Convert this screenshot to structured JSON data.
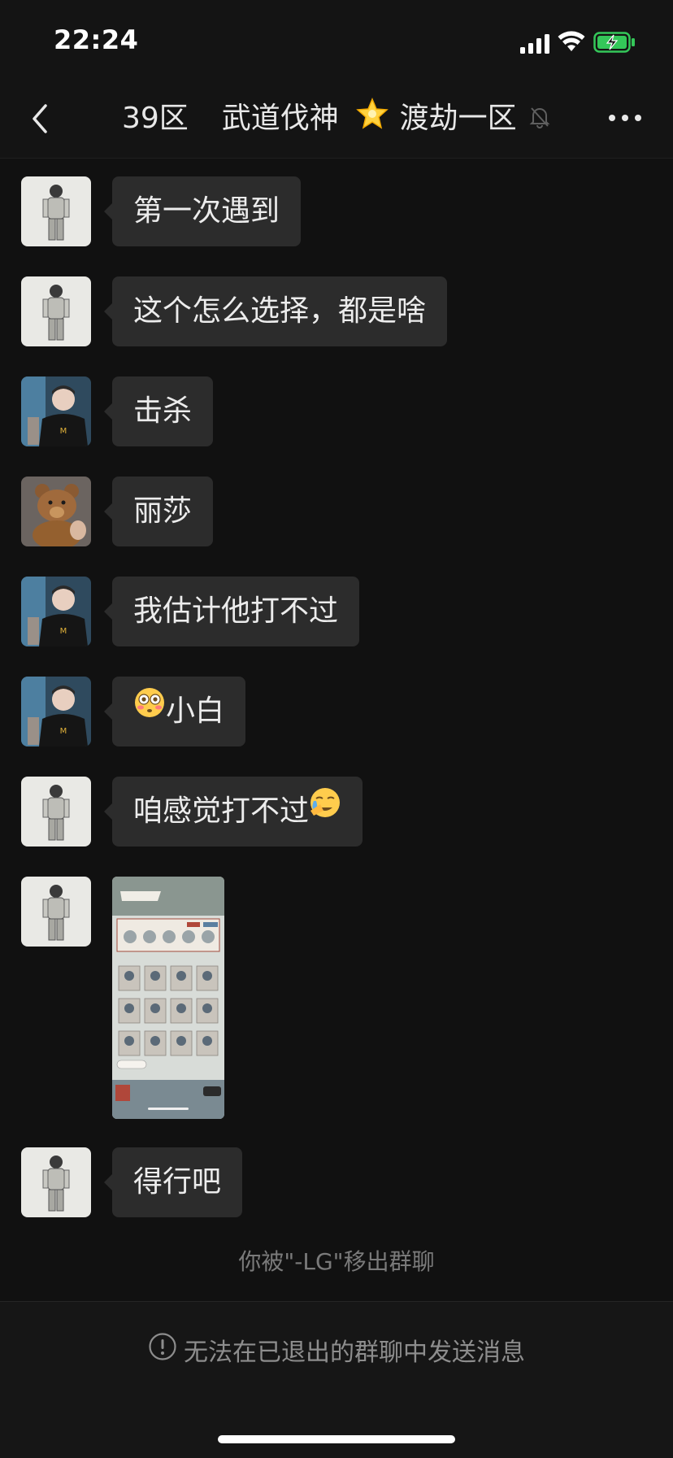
{
  "status_bar": {
    "time": "22:24",
    "icons": [
      "signal-icon",
      "wifi-icon",
      "battery-charging-icon"
    ],
    "battery_color": "#34c759"
  },
  "nav": {
    "title_zone": "39区",
    "title_name": "武道伐神",
    "title_suffix": "渡劫一区",
    "icons": [
      "back-icon",
      "star-emoji-icon",
      "mute-icon",
      "more-icon"
    ]
  },
  "messages": [
    {
      "avatar": "sketch-avatar",
      "text": "第一次遇到"
    },
    {
      "avatar": "sketch-avatar",
      "text": "这个怎么选择，都是啥"
    },
    {
      "avatar": "photo-avatar-man",
      "text": "击杀"
    },
    {
      "avatar": "photo-avatar-bear",
      "text": "丽莎"
    },
    {
      "avatar": "photo-avatar-man",
      "text": "我估计他打不过"
    },
    {
      "avatar": "photo-avatar-man",
      "emoji": "flushed-face-emoji-icon",
      "text": "小白"
    },
    {
      "avatar": "sketch-avatar",
      "text": "咱感觉打不过",
      "emoji": "crying-face-emoji-icon"
    },
    {
      "avatar": "sketch-avatar",
      "image": "game-screenshot-thumbnail"
    },
    {
      "avatar": "sketch-avatar",
      "text": "得行吧"
    }
  ],
  "system_note": "你被\"-LG\"移出群聊",
  "bottom_bar": {
    "notice": "无法在已退出的群聊中发送消息",
    "icon": "info-icon"
  },
  "colors": {
    "background": "#111111",
    "bubble": "#2c2c2c",
    "text": "#ececec",
    "muted_text": "#7a7a7a"
  }
}
